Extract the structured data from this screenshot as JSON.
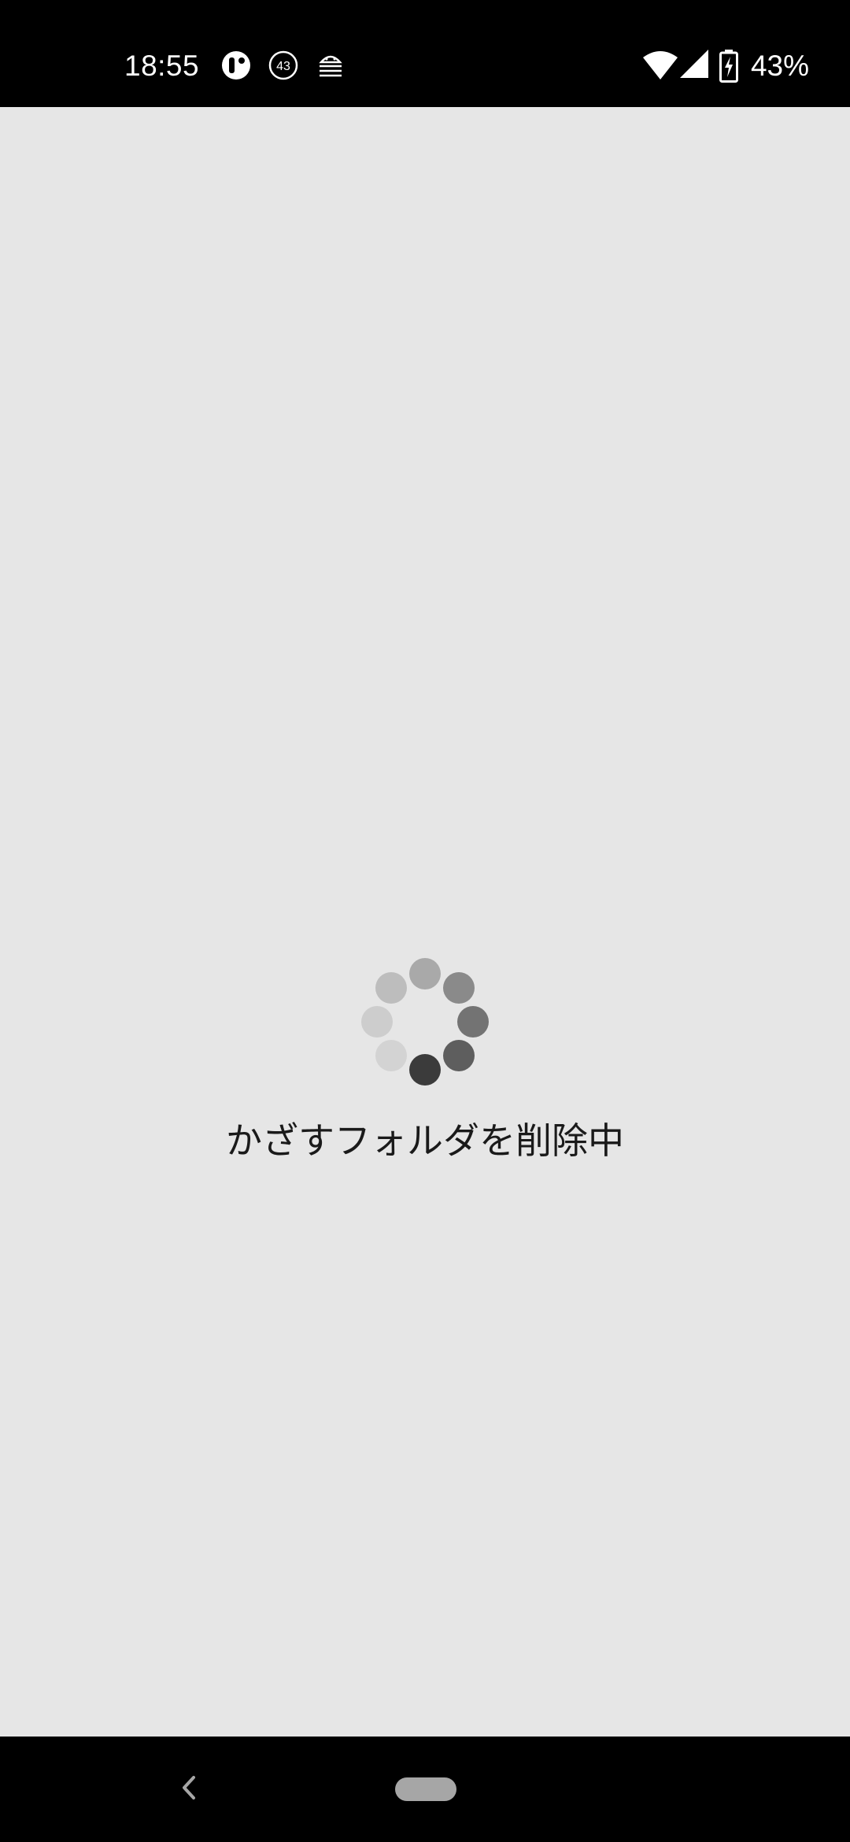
{
  "status_bar": {
    "time": "18:55",
    "notification_icons": [
      "app-notification-icon",
      "badge-43-icon",
      "android-debug-icon"
    ],
    "badge_count": "43",
    "wifi_icon": "wifi-icon",
    "signal_icon": "cell-signal-icon",
    "battery_icon": "battery-charging-icon",
    "battery_percent": "43%"
  },
  "loading": {
    "message": "かざすフォルダを削除中",
    "spinner_icon": "loading-spinner-icon"
  },
  "nav_bar": {
    "back_icon": "back-icon",
    "home_icon": "home-pill-icon"
  },
  "colors": {
    "status_bar_bg": "#000000",
    "content_bg": "#e6e6e6",
    "text": "#1a1a1a",
    "nav_bar_bg": "#000000"
  }
}
